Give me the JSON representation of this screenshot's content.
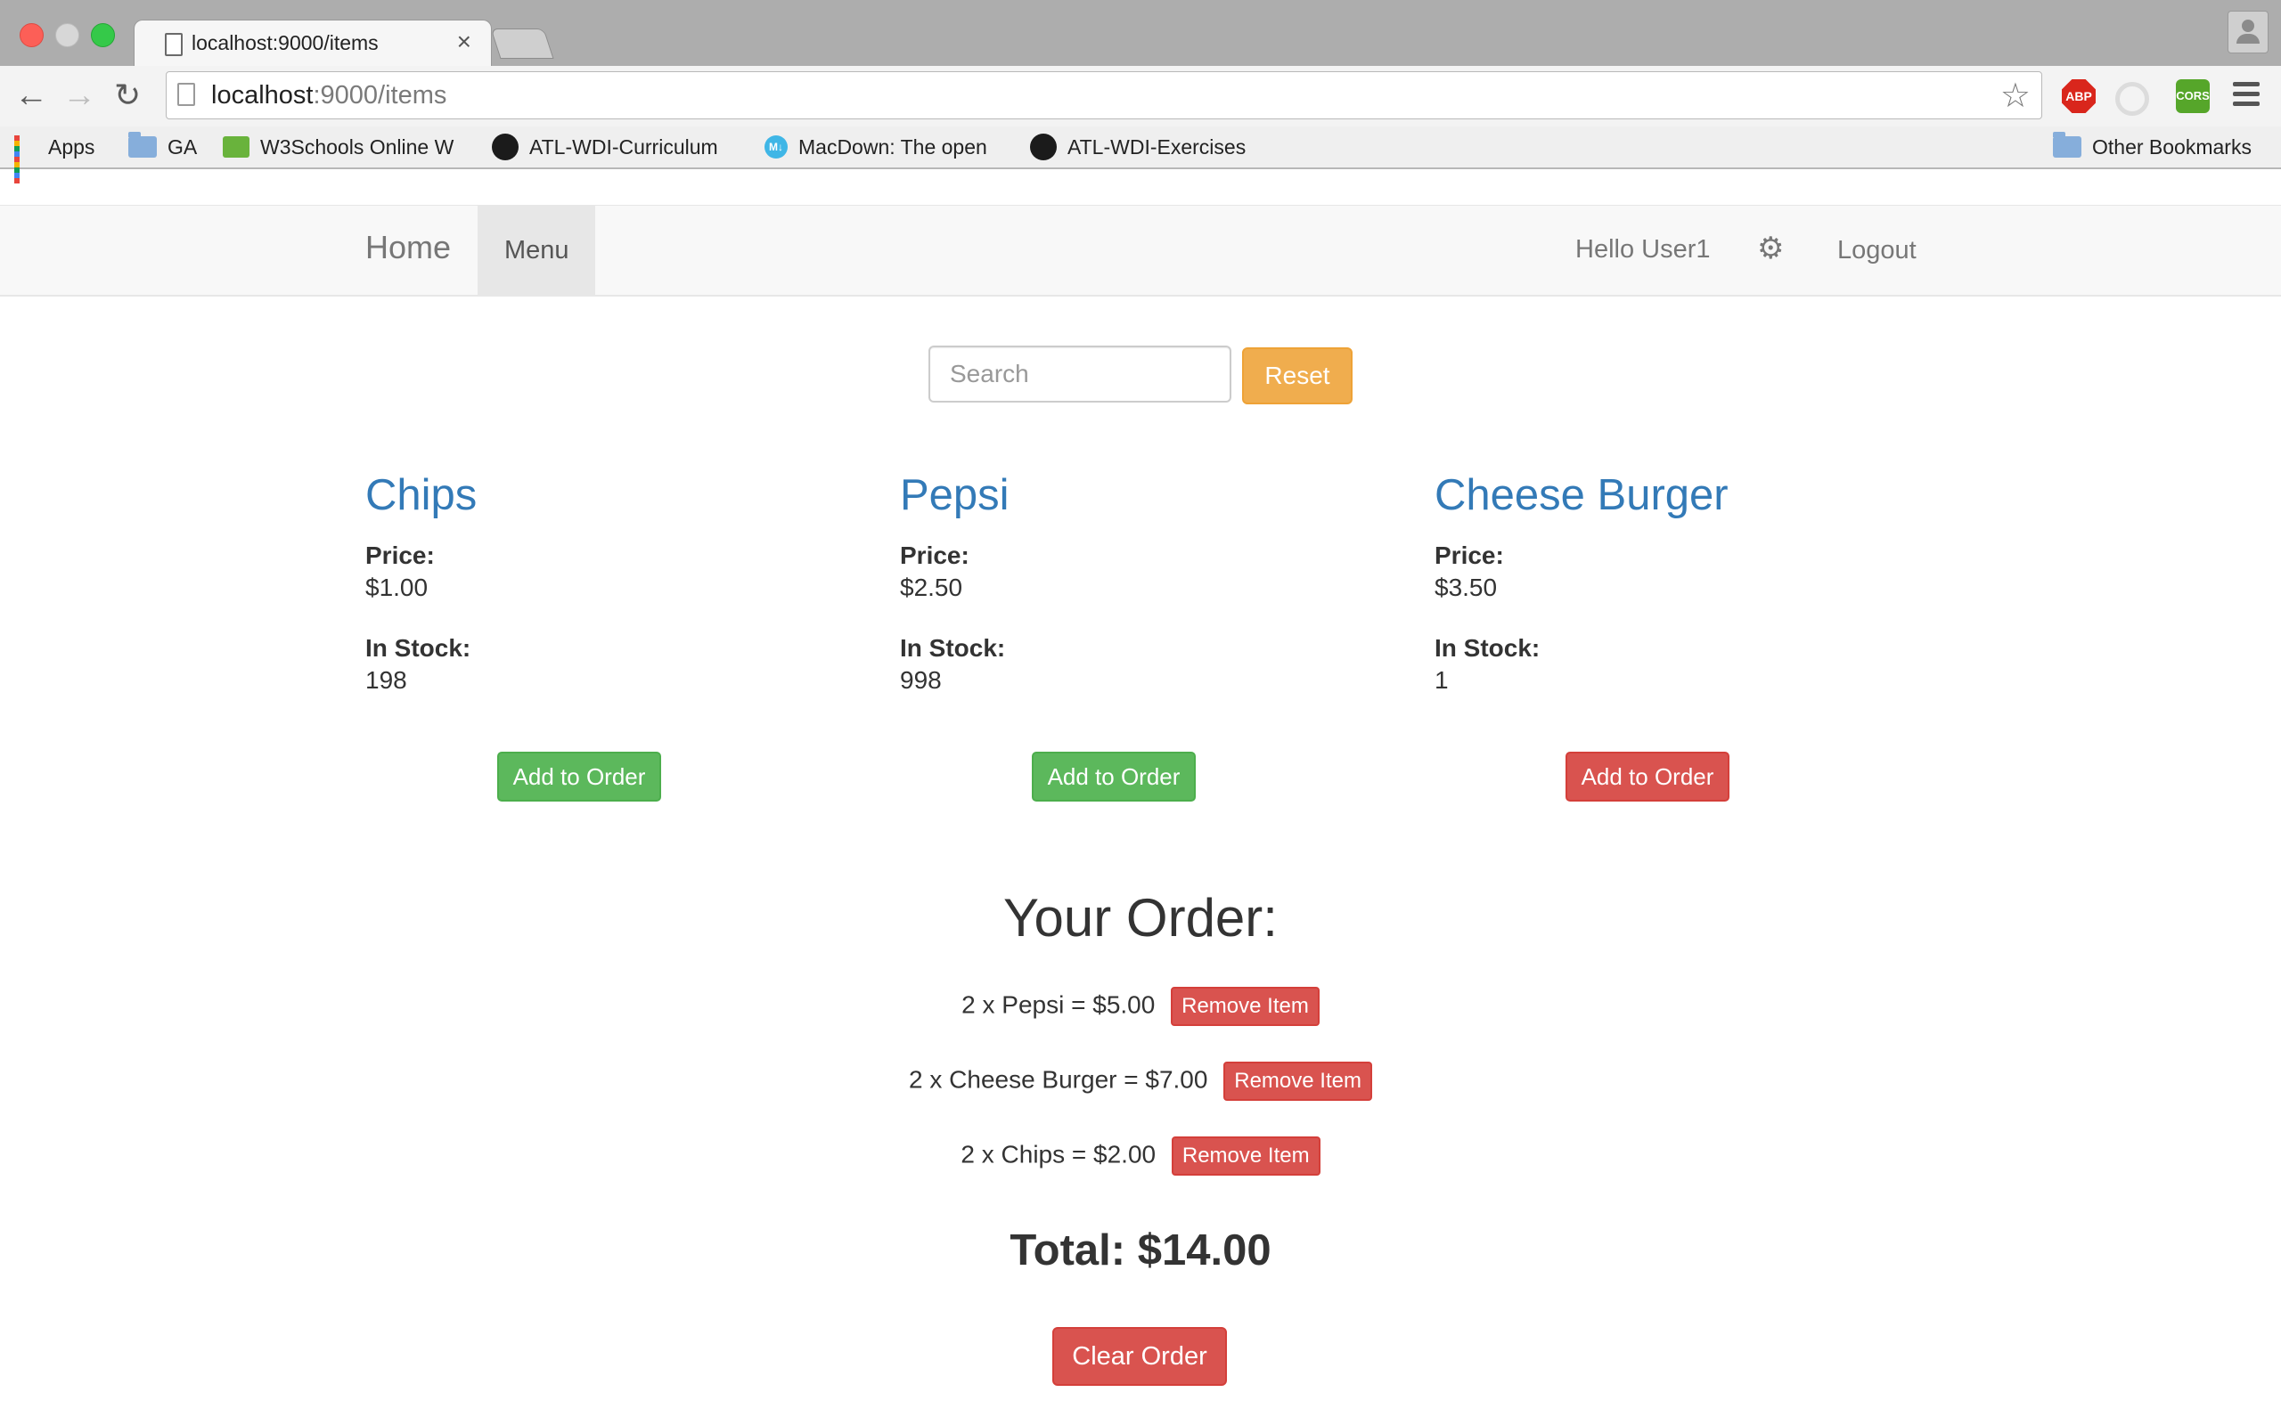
{
  "browser": {
    "tab_title": "localhost:9000/items",
    "tab_close": "×",
    "url_host": "localhost",
    "url_path": ":9000/items",
    "ext_abp": "ABP",
    "ext_cors": "CORS",
    "bookmarks": [
      {
        "label": "Apps",
        "icon": "apps-grid-icon"
      },
      {
        "label": "GA",
        "icon": "folder-icon"
      },
      {
        "label": "W3Schools Online W",
        "icon": "w3schools-icon"
      },
      {
        "label": "ATL-WDI-Curriculum",
        "icon": "github-icon"
      },
      {
        "label": "MacDown: The open",
        "icon": "macdown-icon"
      },
      {
        "label": "ATL-WDI-Exercises",
        "icon": "github-icon"
      }
    ],
    "other_bookmarks": "Other Bookmarks"
  },
  "nav": {
    "brand": "Home",
    "menu": "Menu",
    "greeting": "Hello User1",
    "gear": "⚙",
    "logout": "Logout"
  },
  "search": {
    "placeholder": "Search",
    "value": "",
    "reset_label": "Reset"
  },
  "items": [
    {
      "name": "Chips",
      "price_label": "Price:",
      "price": "$1.00",
      "stock_label": "In Stock:",
      "stock": "198",
      "button": "Add to Order",
      "button_color": "#5cb85c"
    },
    {
      "name": "Pepsi",
      "price_label": "Price:",
      "price": "$2.50",
      "stock_label": "In Stock:",
      "stock": "998",
      "button": "Add to Order",
      "button_color": "#5cb85c"
    },
    {
      "name": "Cheese Burger",
      "price_label": "Price:",
      "price": "$3.50",
      "stock_label": "In Stock:",
      "stock": "1",
      "button": "Add to Order",
      "button_color": "#d9534f"
    }
  ],
  "order": {
    "title": "Your Order:",
    "lines": [
      {
        "text": "2 x Pepsi = $5.00",
        "button": "Remove Item"
      },
      {
        "text": "2 x Cheese Burger = $7.00",
        "button": "Remove Item"
      },
      {
        "text": "2 x Chips = $2.00",
        "button": "Remove Item"
      }
    ],
    "total": "Total: $14.00",
    "clear_label": "Clear Order"
  },
  "colors": {
    "link_blue": "#337ab7",
    "success": "#5cb85c",
    "danger": "#d9534f",
    "warning": "#f0ad4e"
  }
}
